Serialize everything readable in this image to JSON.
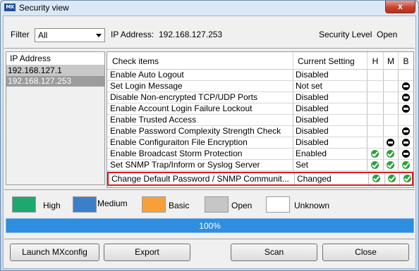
{
  "window": {
    "app_icon_text": "MX",
    "title": "Security view",
    "close_symbol": "x"
  },
  "toolbar": {
    "filter_label": "Filter",
    "filter_value": "All",
    "ip_label": "IP Address:",
    "ip_value": "192.168.127.253",
    "security_label": "Security Level",
    "security_value": "Open"
  },
  "ip_list": {
    "header": "IP Address",
    "items": [
      "192.168.127.1",
      "192.168.127.253"
    ]
  },
  "table": {
    "headers": [
      "Check items",
      "Current Setting",
      "H",
      "M",
      "B"
    ],
    "rows": [
      {
        "item": "Enable Auto Logout",
        "setting": "Disabled",
        "h": "",
        "m": "",
        "b": ""
      },
      {
        "item": "Set Login Message",
        "setting": "Not set",
        "h": "",
        "m": "",
        "b": "minus"
      },
      {
        "item": "Disable Non-encrypted TCP/UDP Ports",
        "setting": "Disabled",
        "h": "",
        "m": "",
        "b": "minus"
      },
      {
        "item": "Enable Account Login Failure Lockout",
        "setting": "Disabled",
        "h": "",
        "m": "",
        "b": "minus"
      },
      {
        "item": "Enable Trusted Access",
        "setting": "Disabled",
        "h": "",
        "m": "",
        "b": ""
      },
      {
        "item": "Enable Password Complexity Strength Check",
        "setting": "Disabled",
        "h": "",
        "m": "",
        "b": "minus"
      },
      {
        "item": "Enable Configuraiton File Encryption",
        "setting": "Disabled",
        "h": "",
        "m": "minus",
        "b": "minus"
      },
      {
        "item": "Enable Broadcast Storm Protection",
        "setting": "Enabled",
        "h": "check",
        "m": "check",
        "b": "minus"
      },
      {
        "item": "Set SNMP Trap/Inform or Syslog Server",
        "setting": "Set",
        "h": "check",
        "m": "check",
        "b": "check"
      },
      {
        "item": "Change Default Password / SNMP Communit...",
        "setting": "Changed",
        "h": "check",
        "m": "check",
        "b": "check"
      }
    ]
  },
  "legend": [
    {
      "label": "High",
      "color": "#1ea86f"
    },
    {
      "label": "Medium",
      "color": "#3b7fcb"
    },
    {
      "label": "Basic",
      "color": "#f7a03a"
    },
    {
      "label": "Open",
      "color": "#c6c6c6"
    },
    {
      "label": "Unknown",
      "color": "#ffffff"
    }
  ],
  "progress": {
    "value": 1.0,
    "text": "100%"
  },
  "buttons": {
    "launch": "Launch MXconfig",
    "export": "Export",
    "scan": "Scan",
    "close": "Close"
  }
}
